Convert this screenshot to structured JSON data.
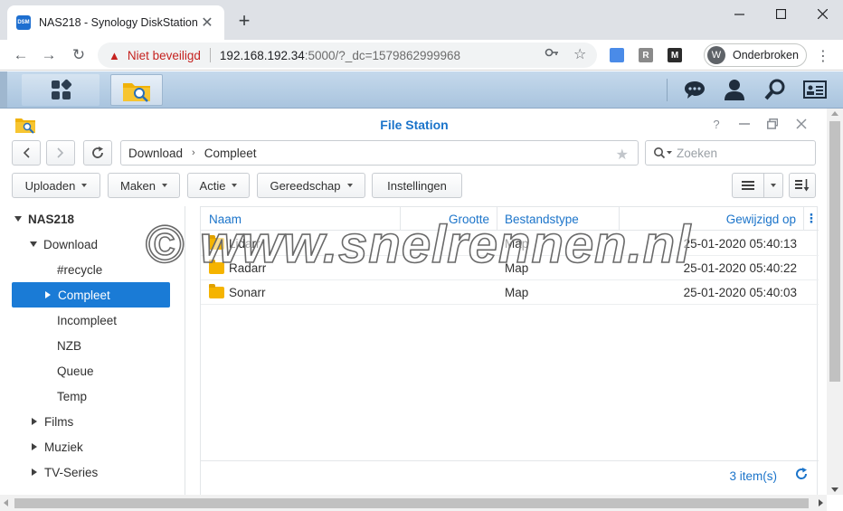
{
  "browser": {
    "tab": {
      "favicon_text": "DSM",
      "title": "NAS218 - Synology DiskStation"
    },
    "address": {
      "security_label": "Niet beveiligd",
      "url_main": "192.168.192.34",
      "url_rest": ":5000/?_dc=1579862999968"
    },
    "extensions": [
      {
        "name": "extension-1-icon",
        "letter": "",
        "color": "#4a8be8"
      },
      {
        "name": "extension-r-icon",
        "letter": "R",
        "color": "#8a8a8a"
      },
      {
        "name": "extension-m-icon",
        "letter": "M",
        "color": "#2b2b2b"
      }
    ],
    "profile": {
      "initial": "W",
      "label": "Onderbroken"
    }
  },
  "window": {
    "title": "File Station",
    "path": [
      "Download",
      "Compleet"
    ],
    "search_placeholder": "Zoeken"
  },
  "toolbar": {
    "upload": "Uploaden",
    "create": "Maken",
    "action": "Actie",
    "tools": "Gereedschap",
    "settings": "Instellingen"
  },
  "sidebar": {
    "root": "NAS218",
    "download": "Download",
    "download_children": [
      "#recycle",
      "Compleet",
      "Incompleet",
      "NZB",
      "Queue",
      "Temp"
    ],
    "others": [
      "Films",
      "Muziek",
      "TV-Series"
    ]
  },
  "list": {
    "columns": {
      "name": "Naam",
      "size": "Grootte",
      "type": "Bestandstype",
      "modified": "Gewijzigd op"
    },
    "rows": [
      {
        "name": "Lidarr",
        "size": "",
        "type": "Map",
        "modified": "25-01-2020 05:40:13"
      },
      {
        "name": "Radarr",
        "size": "",
        "type": "Map",
        "modified": "25-01-2020 05:40:22"
      },
      {
        "name": "Sonarr",
        "size": "",
        "type": "Map",
        "modified": "25-01-2020 05:40:03"
      }
    ],
    "count": "3 item(s)"
  },
  "watermark": "© www.snelrennen.nl",
  "colors": {
    "accent": "#1a7bd6",
    "link": "#1b74ca",
    "taskbar": "#b4cce4",
    "folder": "#f5b400"
  }
}
